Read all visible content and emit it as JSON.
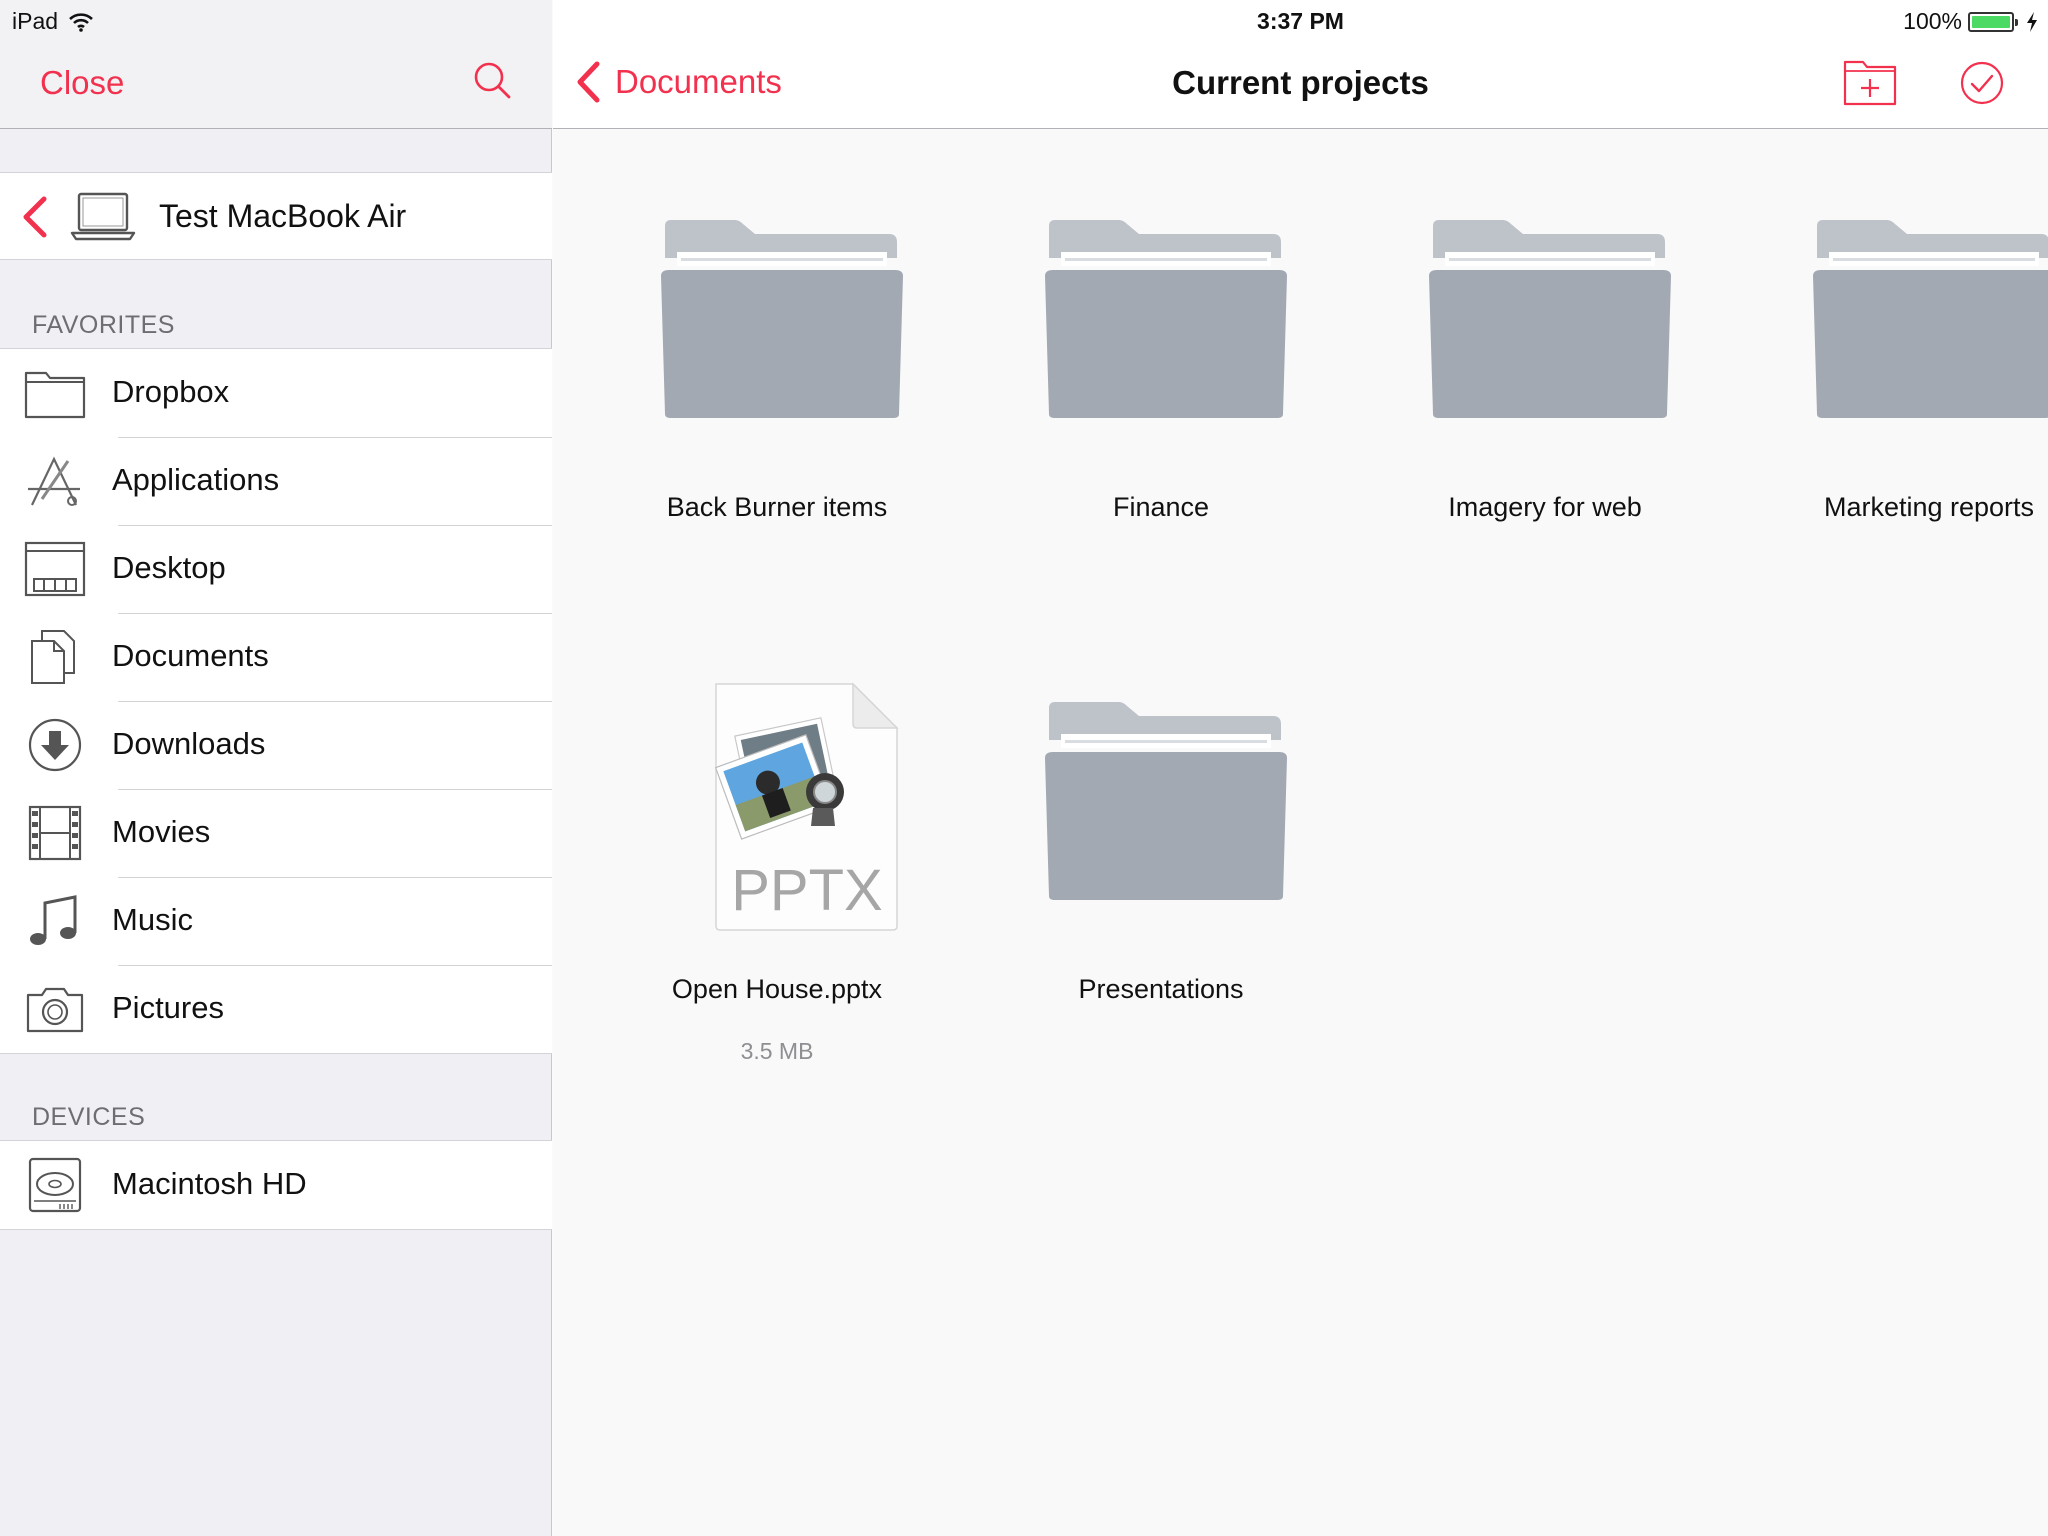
{
  "status_bar": {
    "device": "iPad",
    "time": "3:37 PM",
    "battery": "100%"
  },
  "sidebar": {
    "close_label": "Close",
    "device": {
      "name": "Test MacBook Air"
    },
    "favorites_header": "FAVORITES",
    "favorites": [
      {
        "label": "Dropbox",
        "icon": "dropbox-folder-icon"
      },
      {
        "label": "Applications",
        "icon": "applications-icon"
      },
      {
        "label": "Desktop",
        "icon": "desktop-icon"
      },
      {
        "label": "Documents",
        "icon": "documents-icon"
      },
      {
        "label": "Downloads",
        "icon": "downloads-icon"
      },
      {
        "label": "Movies",
        "icon": "movies-icon"
      },
      {
        "label": "Music",
        "icon": "music-icon"
      },
      {
        "label": "Pictures",
        "icon": "pictures-icon"
      }
    ],
    "devices_header": "DEVICES",
    "devices": [
      {
        "label": "Macintosh HD",
        "icon": "hard-drive-icon"
      }
    ]
  },
  "main": {
    "back_label": "Documents",
    "title": "Current projects",
    "items": [
      {
        "name": "Back Burner items",
        "type": "folder"
      },
      {
        "name": "Finance",
        "type": "folder"
      },
      {
        "name": "Imagery for web",
        "type": "folder"
      },
      {
        "name": "Marketing reports",
        "type": "folder"
      },
      {
        "name": "Open House.pptx",
        "type": "pptx",
        "badge": "PPTX",
        "size": "3.5 MB"
      },
      {
        "name": "Presentations",
        "type": "folder"
      }
    ]
  },
  "colors": {
    "accent": "#f2314e",
    "folder": "#a3a9b2",
    "folder_tab": "#bec3ca",
    "battery": "#4cd964"
  }
}
